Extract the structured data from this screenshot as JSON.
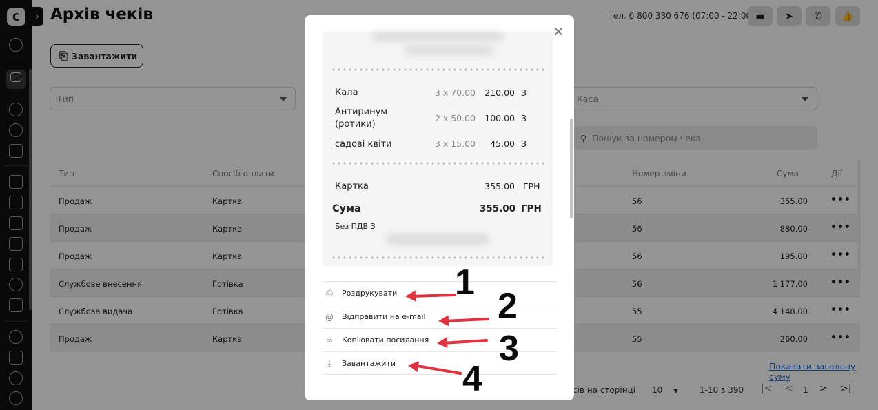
{
  "sidebar": {
    "logo": "C",
    "toggle": "›"
  },
  "header": {
    "title": "Архів чеків",
    "phone": "тел. 0 800 330 676 (07:00 - 22:00)",
    "upload_label": "Завантажити"
  },
  "filters": {
    "type_placeholder": "Тип",
    "cashbox_placeholder": "Каса",
    "search_placeholder": "Пошук за номером чека"
  },
  "table": {
    "headers": {
      "type": "Тип",
      "payment": "Спосіб оплати",
      "shift": "Номер зміни",
      "amount": "Сума",
      "actions": "Дії"
    },
    "rows": [
      {
        "type": "Продаж",
        "payment": "Картка",
        "shift": "56",
        "amount": "355.00"
      },
      {
        "type": "Продаж",
        "payment": "Картка",
        "shift": "56",
        "amount": "880.00"
      },
      {
        "type": "Продаж",
        "payment": "Картка",
        "shift": "56",
        "amount": "195.00"
      },
      {
        "type": "Службове внесення",
        "payment": "Готівка",
        "shift": "56",
        "amount": "1 177.00"
      },
      {
        "type": "Службова видача",
        "payment": "Готівка",
        "shift": "55",
        "amount": "4 148.00"
      },
      {
        "type": "Продаж",
        "payment": "Картка",
        "shift": "55",
        "amount": "260.00"
      }
    ],
    "more_icon": "•••"
  },
  "footer": {
    "total_link": "Показати загальну суму",
    "per_page_label": "сів на сторінці",
    "per_page_value": "10",
    "range": "1-10 з 390",
    "current_page": "1"
  },
  "modal": {
    "close": "✕",
    "items": [
      {
        "name": "Кала",
        "qty": "3 x 70.00",
        "sum": "210.00",
        "tax": "З"
      },
      {
        "name": "Антиринум (ротики)",
        "qty": "2 x 50.00",
        "sum": "100.00",
        "tax": "З"
      },
      {
        "name": "садові квіти",
        "qty": "3 x 15.00",
        "sum": "45.00",
        "tax": "З"
      }
    ],
    "payment": {
      "label": "Картка",
      "amount": "355.00",
      "currency": "ГРН"
    },
    "total": {
      "label": "Сума",
      "amount": "355.00",
      "currency": "ГРН"
    },
    "vat_note": "Без ПДВ З",
    "actions": {
      "print": "Роздрукувати",
      "email": "Відправити на e-mail",
      "copy_link": "Копіювати посилання",
      "download": "Завантажити"
    }
  },
  "annotations": {
    "n1": "1",
    "n2": "2",
    "n3": "3",
    "n4": "4",
    "arrow_color": "#e0333f"
  },
  "colors": {
    "sidebar": "#111111",
    "link": "#1f6fd6",
    "arrow": "#e0333f"
  }
}
